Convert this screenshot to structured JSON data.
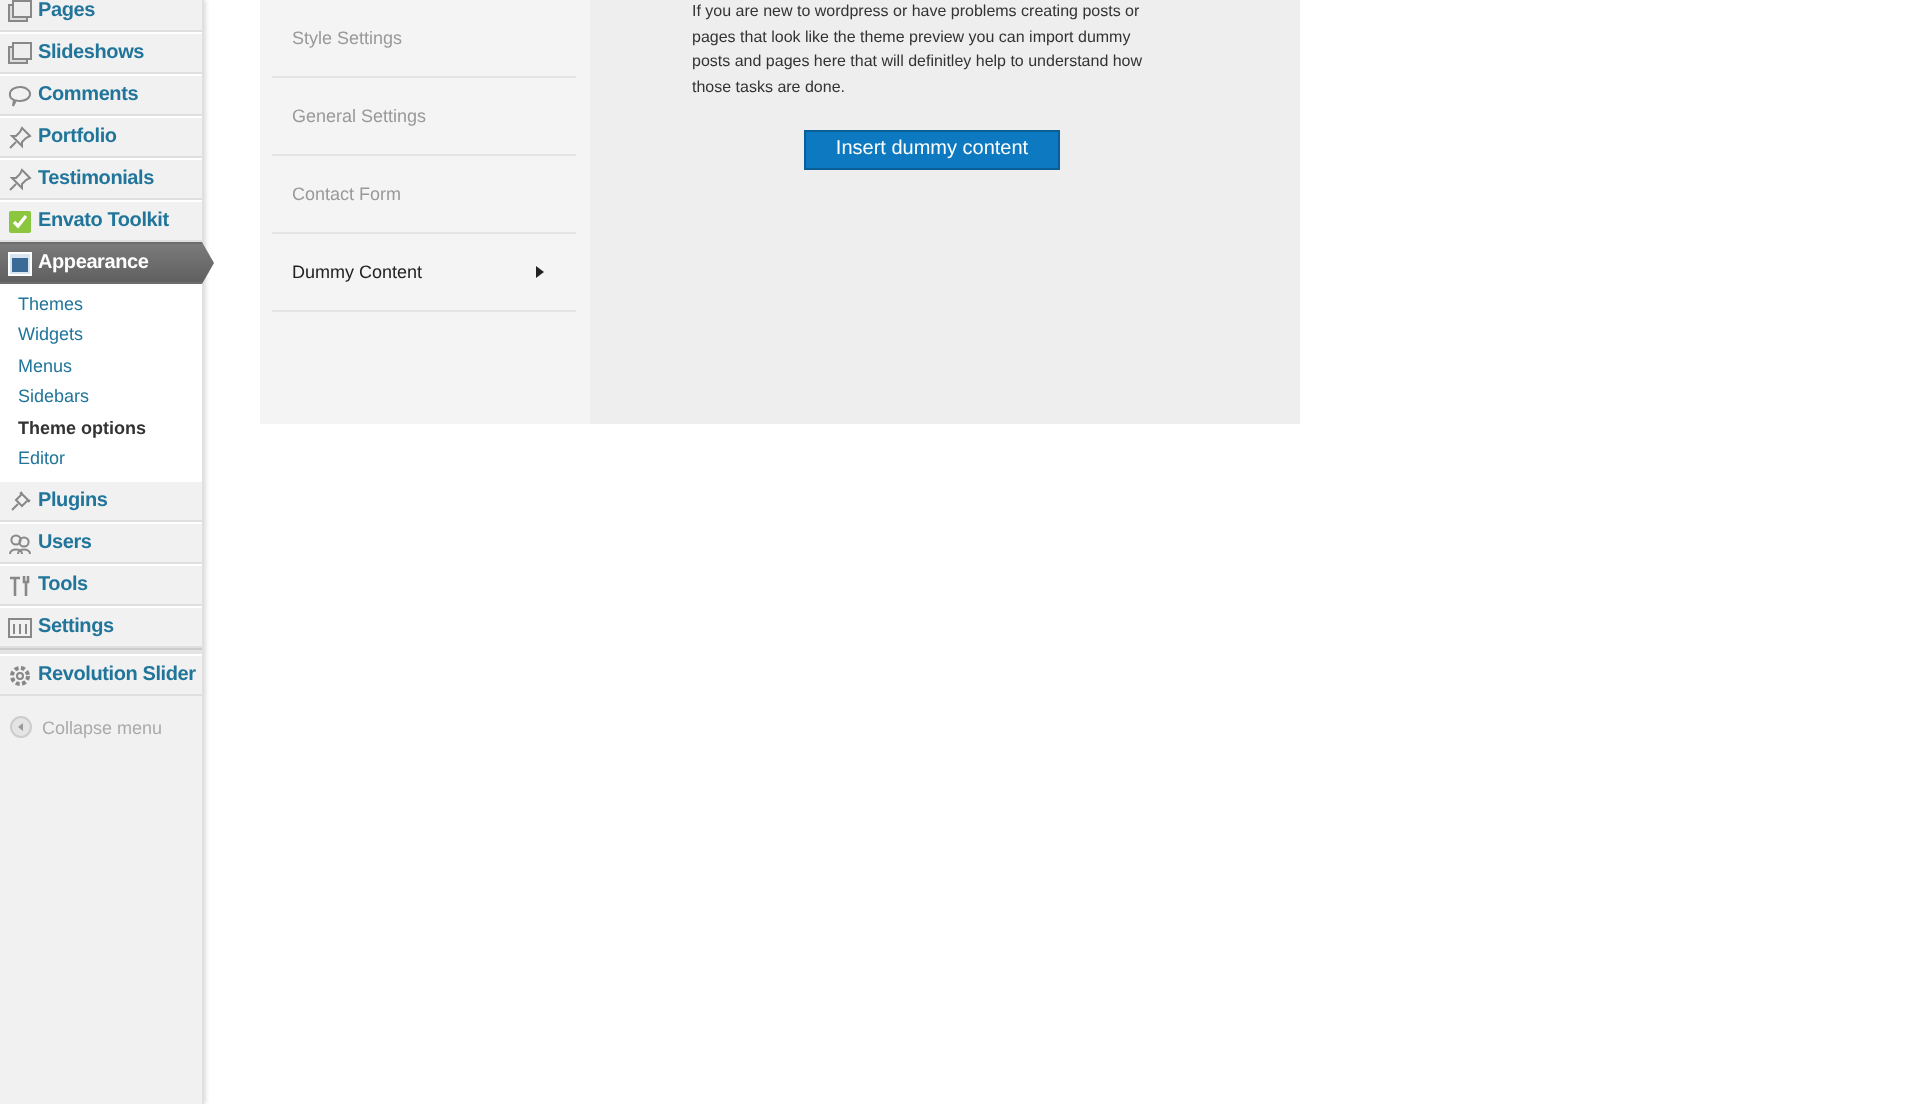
{
  "sidebar": {
    "items": [
      {
        "label": "Pages",
        "selected": false
      },
      {
        "label": "Slideshows",
        "selected": false
      },
      {
        "label": "Comments",
        "selected": false
      },
      {
        "label": "Portfolio",
        "selected": false
      },
      {
        "label": "Testimonials",
        "selected": false
      },
      {
        "label": "Envato Toolkit",
        "selected": false
      },
      {
        "label": "Appearance",
        "selected": true,
        "children": [
          {
            "label": "Themes",
            "selected": false
          },
          {
            "label": "Widgets",
            "selected": false
          },
          {
            "label": "Menus",
            "selected": false
          },
          {
            "label": "Sidebars",
            "selected": false
          },
          {
            "label": "Theme options",
            "selected": true
          },
          {
            "label": "Editor",
            "selected": false
          }
        ]
      },
      {
        "label": "Plugins",
        "selected": false
      },
      {
        "label": "Users",
        "selected": false
      },
      {
        "label": "Tools",
        "selected": false
      },
      {
        "label": "Settings",
        "selected": false
      },
      {
        "label": "Revolution Slider",
        "selected": false
      }
    ],
    "collapse": "Collapse menu"
  },
  "options_nav": [
    {
      "label": "Style Settings",
      "selected": false
    },
    {
      "label": "General Settings",
      "selected": false
    },
    {
      "label": "Contact Form",
      "selected": false
    },
    {
      "label": "Dummy Content",
      "selected": true
    }
  ],
  "dummy": {
    "description": "If you are new to wordpress or have problems creating posts or pages that look like the theme preview you can import dummy posts and pages here that will definitley help to understand how those tasks are done.",
    "button": "Insert dummy content"
  }
}
